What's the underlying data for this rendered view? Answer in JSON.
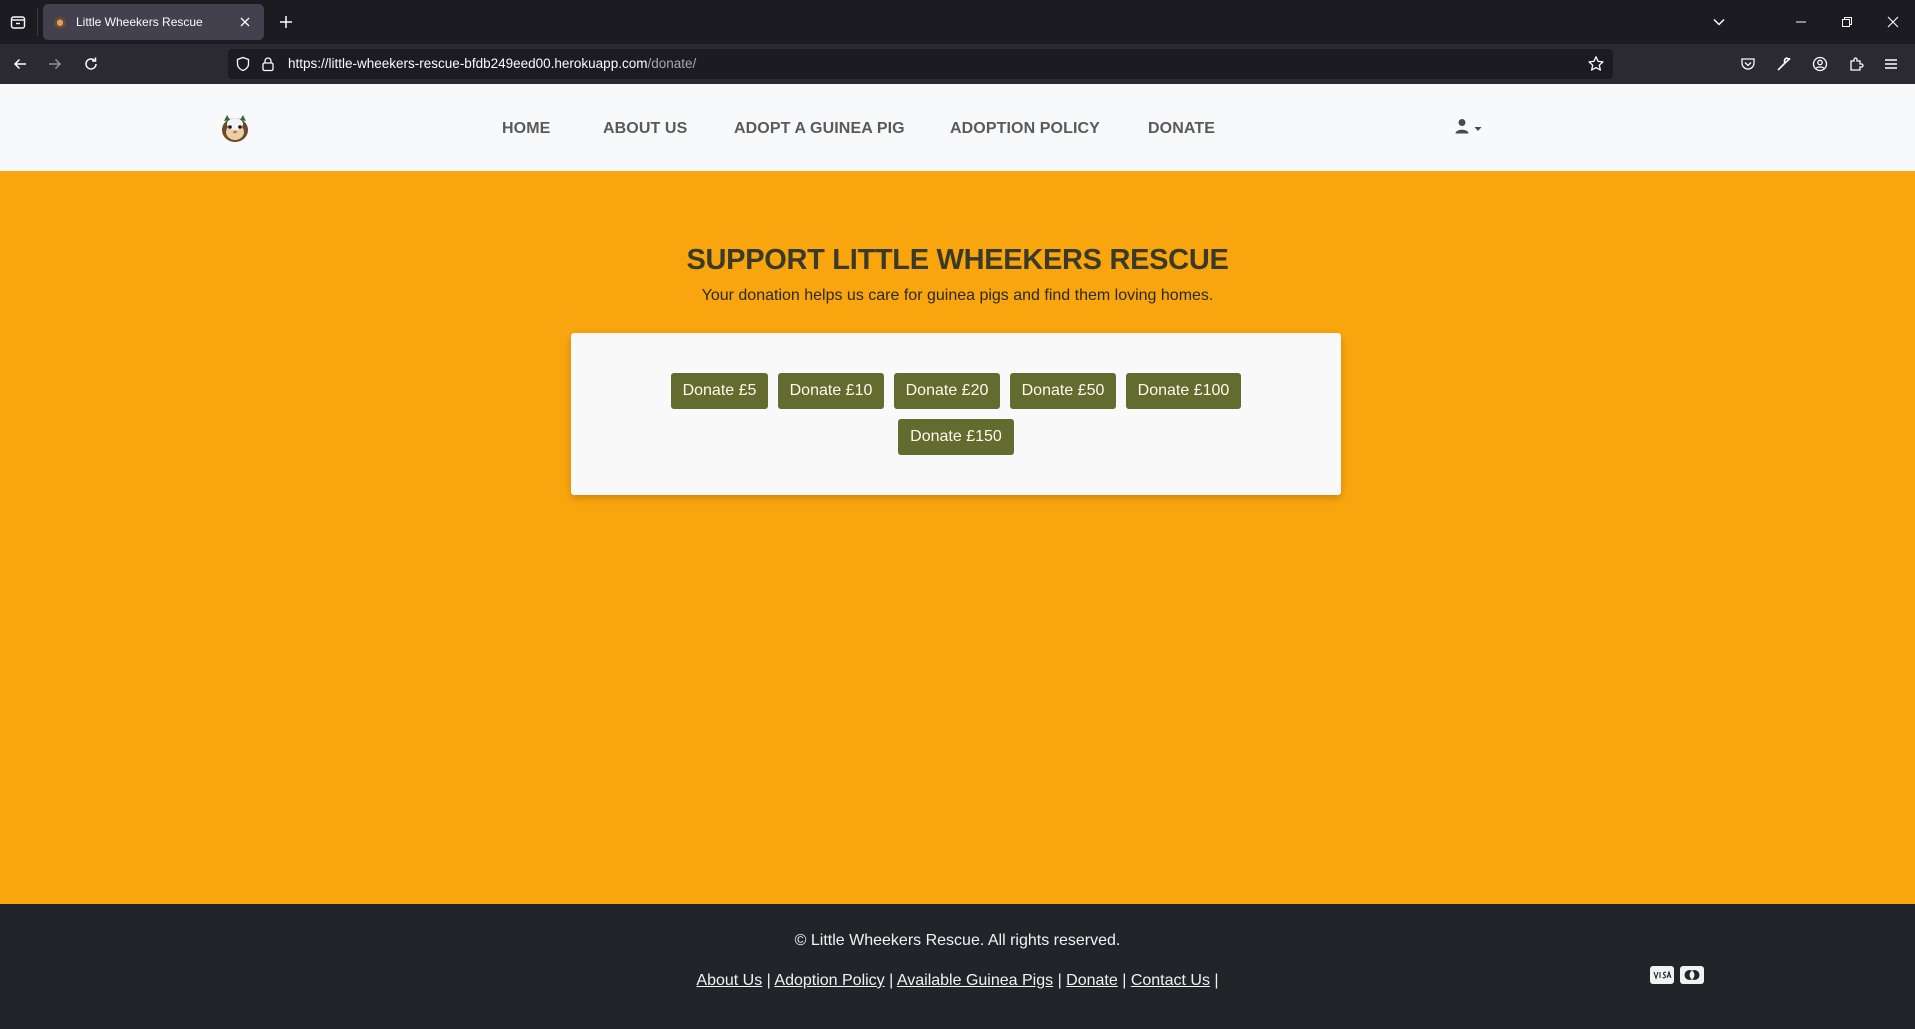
{
  "browser": {
    "tab_title": "Little Wheekers Rescue",
    "url_host": "https://little-wheekers-rescue-bfdb249eed00.herokuapp.com",
    "url_path": "/donate/"
  },
  "nav": {
    "items": [
      {
        "label": "HOME"
      },
      {
        "label": "ABOUT US"
      },
      {
        "label": "ADOPT A GUINEA PIG"
      },
      {
        "label": "ADOPTION POLICY"
      },
      {
        "label": "DONATE"
      }
    ]
  },
  "hero": {
    "title": "SUPPORT LITTLE WHEEKERS RESCUE",
    "subtitle": "Your donation helps us care for guinea pigs and find them loving homes."
  },
  "donate": {
    "buttons": [
      {
        "label": "Donate £5"
      },
      {
        "label": "Donate £10"
      },
      {
        "label": "Donate £20"
      },
      {
        "label": "Donate £50"
      },
      {
        "label": "Donate £100"
      },
      {
        "label": "Donate £150"
      }
    ]
  },
  "footer": {
    "copyright": "© Little Wheekers Rescue. All rights reserved.",
    "links": [
      {
        "label": "About Us"
      },
      {
        "label": "Adoption Policy"
      },
      {
        "label": "Available Guinea Pigs"
      },
      {
        "label": "Donate"
      },
      {
        "label": "Contact Us"
      }
    ],
    "separator": "|",
    "payment_icons": [
      "visa-icon",
      "mastercard-icon"
    ]
  },
  "colors": {
    "page_background": "#f9a50e",
    "button": "#636b2f",
    "footer": "#212529"
  }
}
